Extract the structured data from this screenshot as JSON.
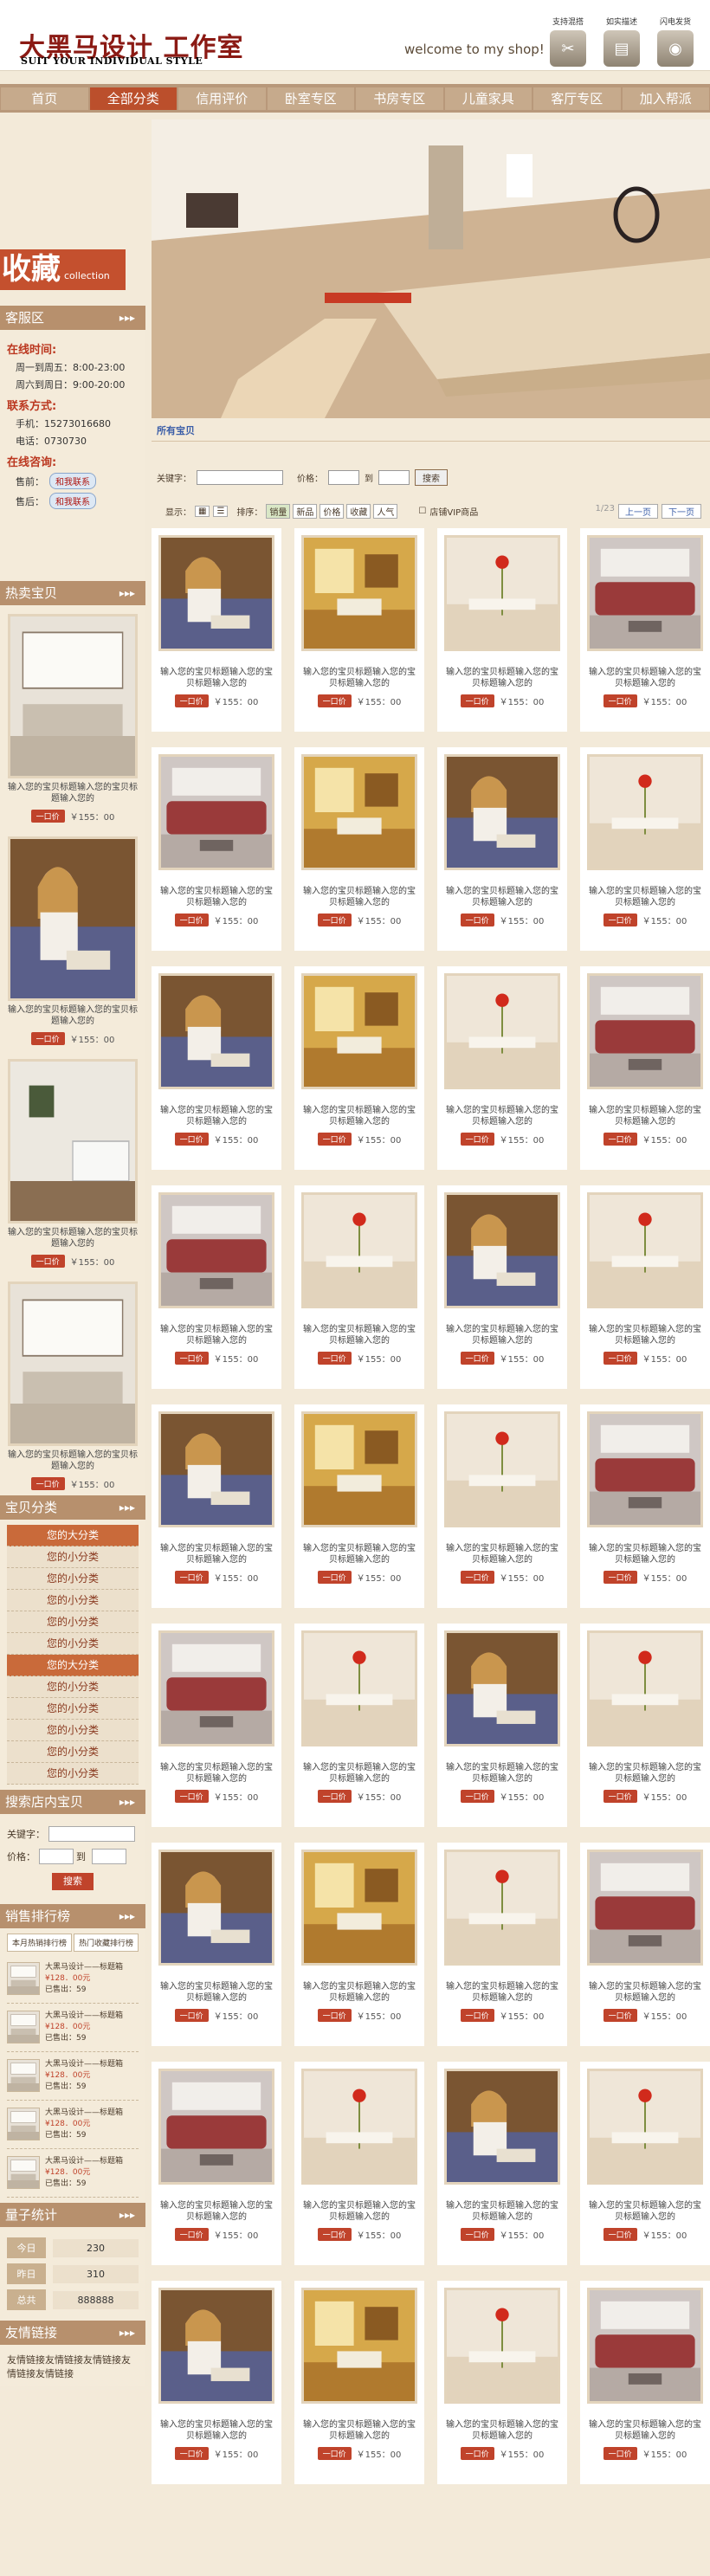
{
  "header": {
    "logo": "大黑马设计 工作室",
    "logo_sub": "SUIT YOUR INDIVIDUAL STYLE",
    "welcome": "welcome to my shop!",
    "links": [
      {
        "label": "支持混搭",
        "icon": "bag-icon"
      },
      {
        "label": "如实描述",
        "icon": "document-icon"
      },
      {
        "label": "闪电发货",
        "icon": "box-icon"
      }
    ]
  },
  "nav": [
    "首页",
    "全部分类",
    "信用评价",
    "卧室专区",
    "书房专区",
    "儿童家具",
    "客厅专区",
    "加入帮派"
  ],
  "nav_active": 1,
  "left": {
    "collect_title": "收藏",
    "collect_en": "collection",
    "service": {
      "title": "客服区",
      "time_h": "在线时间:",
      "time_lines": [
        "周一到周五：8:00-23:00",
        "周六到周日：9:00-20:00"
      ],
      "contact_h": "联系方式:",
      "contact_lines": [
        "手机：15273016680",
        "电话：0730730"
      ],
      "online_h": "在线咨询:",
      "pre_sale": "售前：",
      "after_sale": "售后：",
      "im_label": "和我联系"
    },
    "hot": {
      "title": "热卖宝贝",
      "items": [
        {
          "title": "输入您的宝贝标题输入您的宝贝标题输入您的",
          "tag": "一口价",
          "price": "￥155：00",
          "img": "living-room"
        },
        {
          "title": "输入您的宝贝标题输入您的宝贝标题输入您的",
          "tag": "一口价",
          "price": "￥155：00",
          "img": "woman"
        },
        {
          "title": "输入您的宝贝标题输入您的宝贝标题输入您的",
          "tag": "一口价",
          "price": "￥155：00",
          "img": "white-sofa"
        },
        {
          "title": "输入您的宝贝标题输入您的宝贝标题输入您的",
          "tag": "一口价",
          "price": "￥155：00",
          "img": "living-room"
        }
      ]
    },
    "categories": {
      "title": "宝贝分类",
      "items": [
        {
          "label": "您的大分类",
          "big": true
        },
        {
          "label": "您的小分类",
          "big": false
        },
        {
          "label": "您的小分类",
          "big": false
        },
        {
          "label": "您的小分类",
          "big": false
        },
        {
          "label": "您的小分类",
          "big": false
        },
        {
          "label": "您的小分类",
          "big": false
        },
        {
          "label": "您的大分类",
          "big": true
        },
        {
          "label": "您的小分类",
          "big": false
        },
        {
          "label": "您的小分类",
          "big": false
        },
        {
          "label": "您的小分类",
          "big": false
        },
        {
          "label": "您的小分类",
          "big": false
        },
        {
          "label": "您的小分类",
          "big": false
        }
      ]
    },
    "shop_search": {
      "title": "搜索店内宝贝",
      "keyword": "关键字：",
      "price": "价格：",
      "to": "到",
      "button": "搜索"
    },
    "ranking": {
      "title": "销售排行榜",
      "tabs": [
        "本月热销排行榜",
        "热门收藏排行榜"
      ],
      "items": [
        {
          "title": "大黑马设计——标题箱",
          "price": "¥128．00元",
          "sold": "已售出：59"
        },
        {
          "title": "大黑马设计——标题箱",
          "price": "¥128．00元",
          "sold": "已售出：59"
        },
        {
          "title": "大黑马设计——标题箱",
          "price": "¥128．00元",
          "sold": "已售出：59"
        },
        {
          "title": "大黑马设计——标题箱",
          "price": "¥128．00元",
          "sold": "已售出：59"
        },
        {
          "title": "大黑马设计——标题箱",
          "price": "¥128．00元",
          "sold": "已售出：59"
        }
      ]
    },
    "stats": {
      "title": "量子统计",
      "rows": [
        {
          "label": "今日",
          "value": "230"
        },
        {
          "label": "昨日",
          "value": "310"
        },
        {
          "label": "总共",
          "value": "888888"
        }
      ]
    },
    "friends": {
      "title": "友情链接",
      "text": "友情链接友情链接友情链接友情链接友情链接"
    }
  },
  "main": {
    "tab": "所有宝贝",
    "search": {
      "keyword": "关键字：",
      "price": "价格：",
      "to": "到",
      "button": "搜索"
    },
    "sort": {
      "show": "显示：",
      "sort_label": "排序：",
      "options": [
        "销量",
        "新品",
        "价格",
        "收藏",
        "人气"
      ],
      "vip": "店铺VIP商品",
      "page": "1/23",
      "prev": "上一页",
      "next": "下一页"
    },
    "products": [
      {
        "img": "woman"
      },
      {
        "img": "kitchen"
      },
      {
        "img": "flower"
      },
      {
        "img": "red-sofa"
      },
      {
        "img": "red-sofa"
      },
      {
        "img": "kitchen"
      },
      {
        "img": "woman"
      },
      {
        "img": "flower"
      },
      {
        "img": "woman"
      },
      {
        "img": "kitchen"
      },
      {
        "img": "flower"
      },
      {
        "img": "red-sofa"
      },
      {
        "img": "red-sofa"
      },
      {
        "img": "flower"
      },
      {
        "img": "woman"
      },
      {
        "img": "flower"
      },
      {
        "img": "woman"
      },
      {
        "img": "kitchen"
      },
      {
        "img": "flower"
      },
      {
        "img": "red-sofa"
      },
      {
        "img": "red-sofa"
      },
      {
        "img": "flower"
      },
      {
        "img": "woman"
      },
      {
        "img": "flower"
      },
      {
        "img": "woman"
      },
      {
        "img": "kitchen"
      },
      {
        "img": "flower"
      },
      {
        "img": "red-sofa"
      },
      {
        "img": "red-sofa"
      },
      {
        "img": "flower"
      },
      {
        "img": "woman"
      },
      {
        "img": "flower"
      },
      {
        "img": "woman"
      },
      {
        "img": "kitchen"
      },
      {
        "img": "flower"
      },
      {
        "img": "red-sofa"
      }
    ],
    "product_title": "输入您的宝贝标题输入您的宝贝标题输入您的",
    "product_tag": "一口价",
    "product_price": "￥155：00"
  },
  "colors": {
    "accent": "#c0432b",
    "panel": "#b7906d",
    "background": "#f3ead9"
  }
}
